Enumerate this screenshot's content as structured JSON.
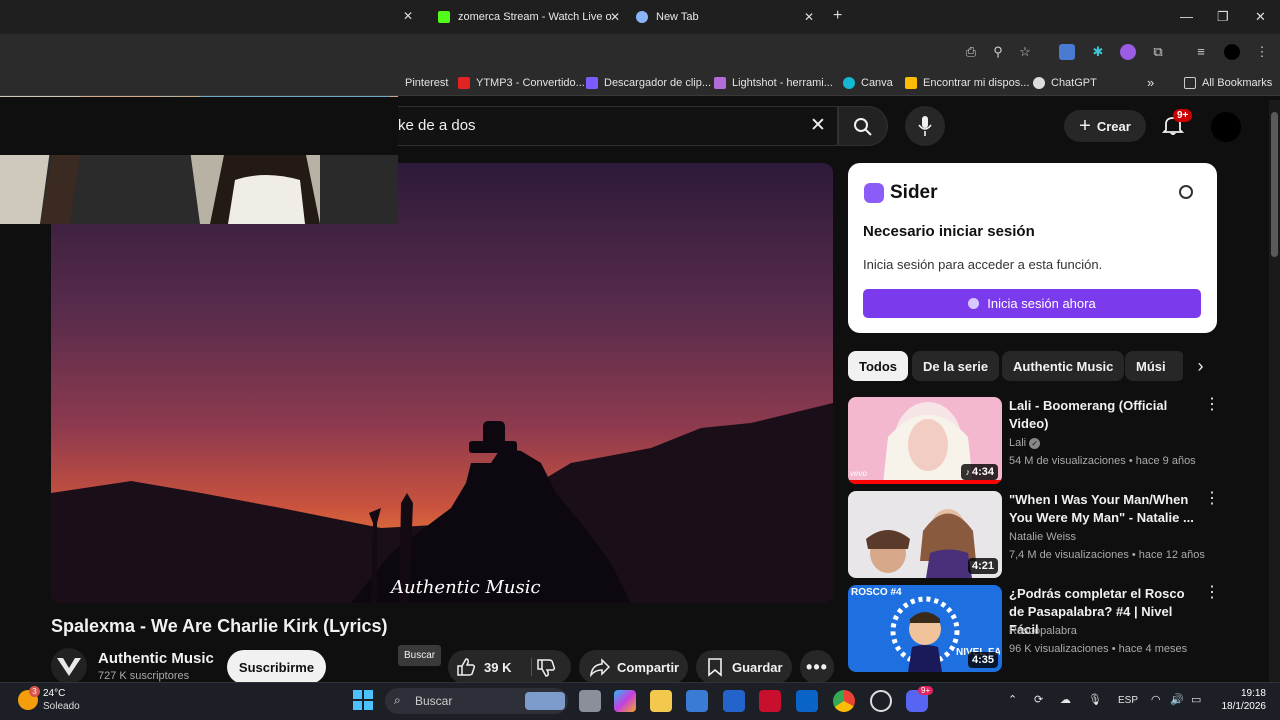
{
  "browser": {
    "tabs": [
      {
        "title": "zomerca Stream - Watch Live o"
      },
      {
        "title": "New Tab"
      }
    ],
    "new_tab": "+",
    "bookmarks": [
      {
        "label": "Pinterest"
      },
      {
        "label": "YTMP3 - Convertido..."
      },
      {
        "label": "Descargador de clip..."
      },
      {
        "label": "Lightshot - herrami..."
      },
      {
        "label": "Canva"
      },
      {
        "label": "Encontrar mi dispos..."
      },
      {
        "label": "ChatGPT"
      }
    ],
    "more_bookmarks": "»",
    "all_bookmarks": "All Bookmarks"
  },
  "youtube": {
    "search_value": "ke de a dos",
    "create_label": "Crear",
    "notif_badge": "9+",
    "video": {
      "watermark": "Authentic Music",
      "title": "Spalexma - We Are Charlie Kirk (Lyrics)",
      "channel": "Authentic Music",
      "subscribers": "727 K suscriptores",
      "subscribe_label": "Suscribirme",
      "likes": "39 K",
      "share_label": "Compartir",
      "save_label": "Guardar",
      "tooltip": "Buscar"
    },
    "sider": {
      "brand": "Sider",
      "heading": "Necesario iniciar sesión",
      "body": "Inicia sesión para acceder a esta función.",
      "button": "Inicia sesión ahora"
    },
    "chips": [
      "Todos",
      "De la serie",
      "Authentic Music",
      "Músi"
    ],
    "recommendations": [
      {
        "title": "Lali - Boomerang (Official Video)",
        "channel": "Lali",
        "meta": "54 M de visualizaciones • hace 9 años",
        "duration": "4:34",
        "thumb_text": "vevo"
      },
      {
        "title": "\"When I Was Your Man/When You Were My Man\" - Natalie ...",
        "channel": "Natalie Weiss",
        "meta": "7,4 M de visualizaciones • hace 12 años",
        "duration": "4:21",
        "thumb_text": ""
      },
      {
        "title": "¿Podrás completar el Rosco de Pasapalabra? #4 | Nivel Fácil",
        "channel": "Roscopalabra",
        "meta": "96 K visualizaciones • hace 4 meses",
        "duration": "4:35",
        "thumb_text": "ROSCO #4",
        "thumb_text2": "NIVEL FÁ"
      }
    ]
  },
  "taskbar": {
    "weather_temp": "24°C",
    "weather_desc": "Soleado",
    "weather_badge": "3",
    "search_placeholder": "Buscar",
    "lang": "ESP",
    "time": "19:18",
    "date": "18/1/2026",
    "discord_badge": "9+"
  },
  "colors": {
    "accent_purple": "#7c3aed",
    "yt_bg": "#0f0f0f",
    "notif_red": "#cc0000"
  }
}
